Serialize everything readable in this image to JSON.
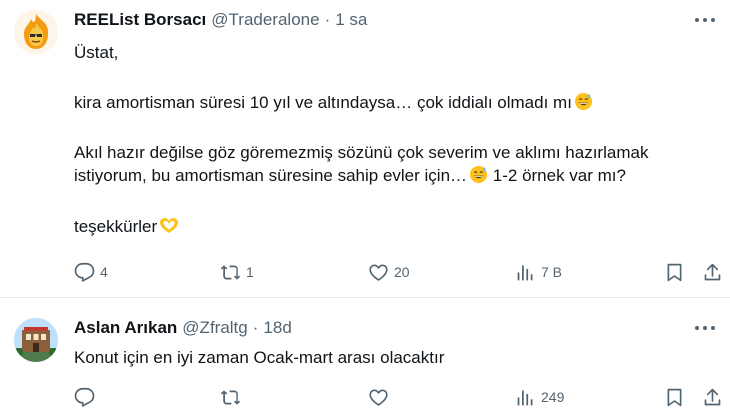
{
  "tweets": [
    {
      "author": "REEList Borsacı",
      "handle": "@Traderalone",
      "time": "1 sa",
      "lines": [
        "Üstat,",
        "kira amortisman süresi 10 yıl ve altındaysa… çok iddialı olmadı mı",
        "Akıl hazır değilse göz göremezmiş sözünü çok severim ve aklımı hazırlamak",
        "istiyorum, bu amortisman süresine sahip evler için…",
        " 1-2 örnek var mı?",
        "teşekkürler"
      ],
      "actions": {
        "replies": "4",
        "reposts": "1",
        "likes": "20",
        "views": "7 B"
      }
    },
    {
      "author": "Aslan Arıkan",
      "handle": "@Zfraltg",
      "time": "18d",
      "lines": [
        "Konut için en iyi zaman Ocak-mart arası olacaktır"
      ],
      "actions": {
        "views": "249"
      }
    }
  ],
  "dot": "·",
  "icons": [
    "fire-face-avatar",
    "more-icon",
    "reply-icon",
    "repost-icon",
    "like-icon",
    "views-icon",
    "bookmark-icon",
    "share-icon",
    "sweat-smile-emoji",
    "heart-hands-emoji"
  ],
  "colors": {
    "text": "#0f1419",
    "muted": "#536471",
    "divider": "#e6ecf0"
  }
}
